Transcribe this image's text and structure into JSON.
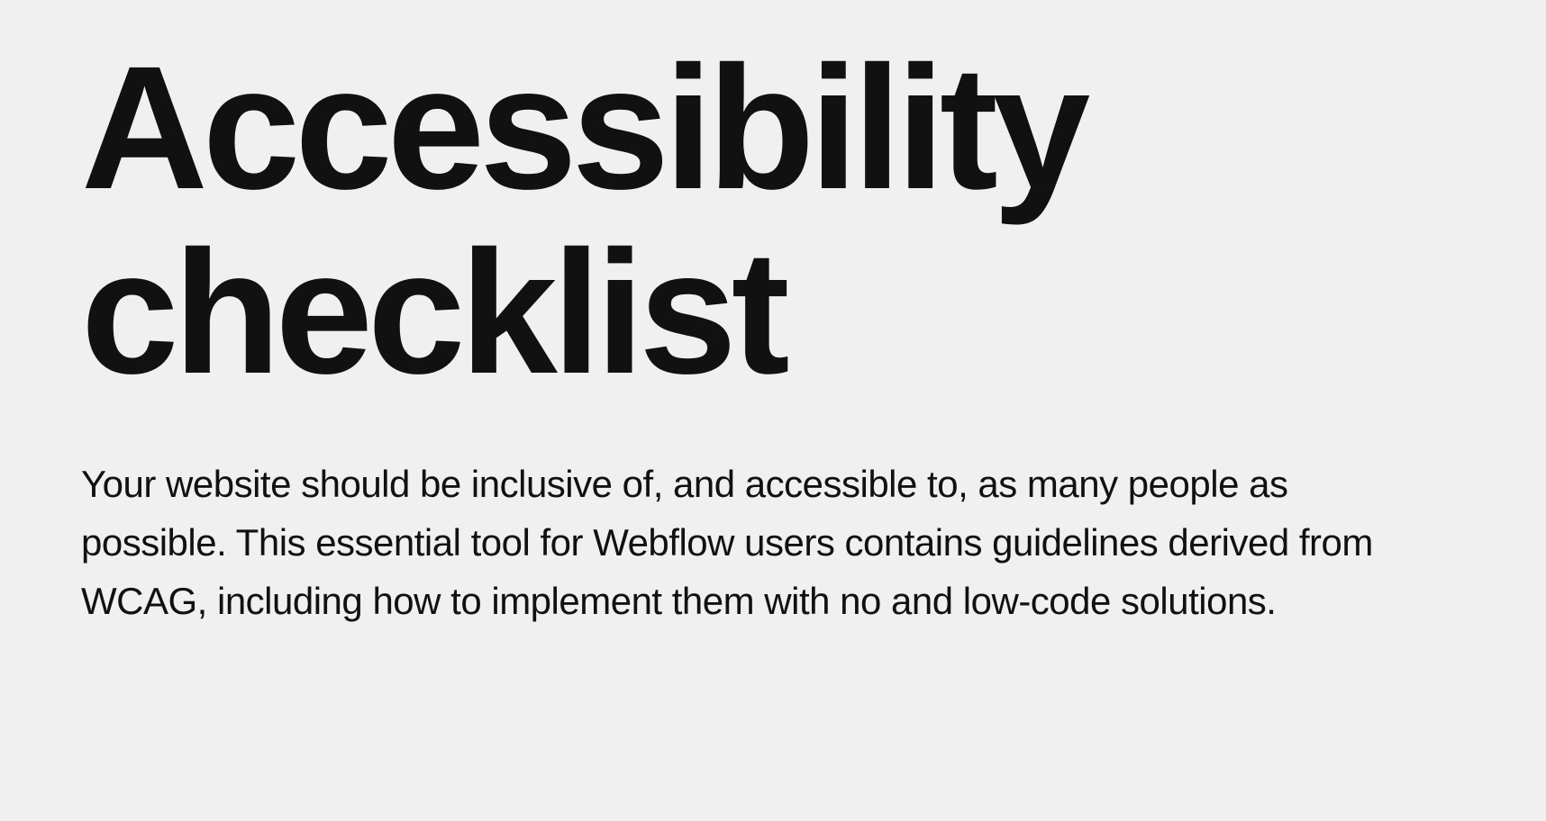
{
  "title": "Accessibility checklist",
  "description": "Your website should be inclusive of, and accessible to, as many people as possible. This essential tool for Webflow users contains guidelines derived from WCAG, including how to implement them with no and low-code solutions."
}
